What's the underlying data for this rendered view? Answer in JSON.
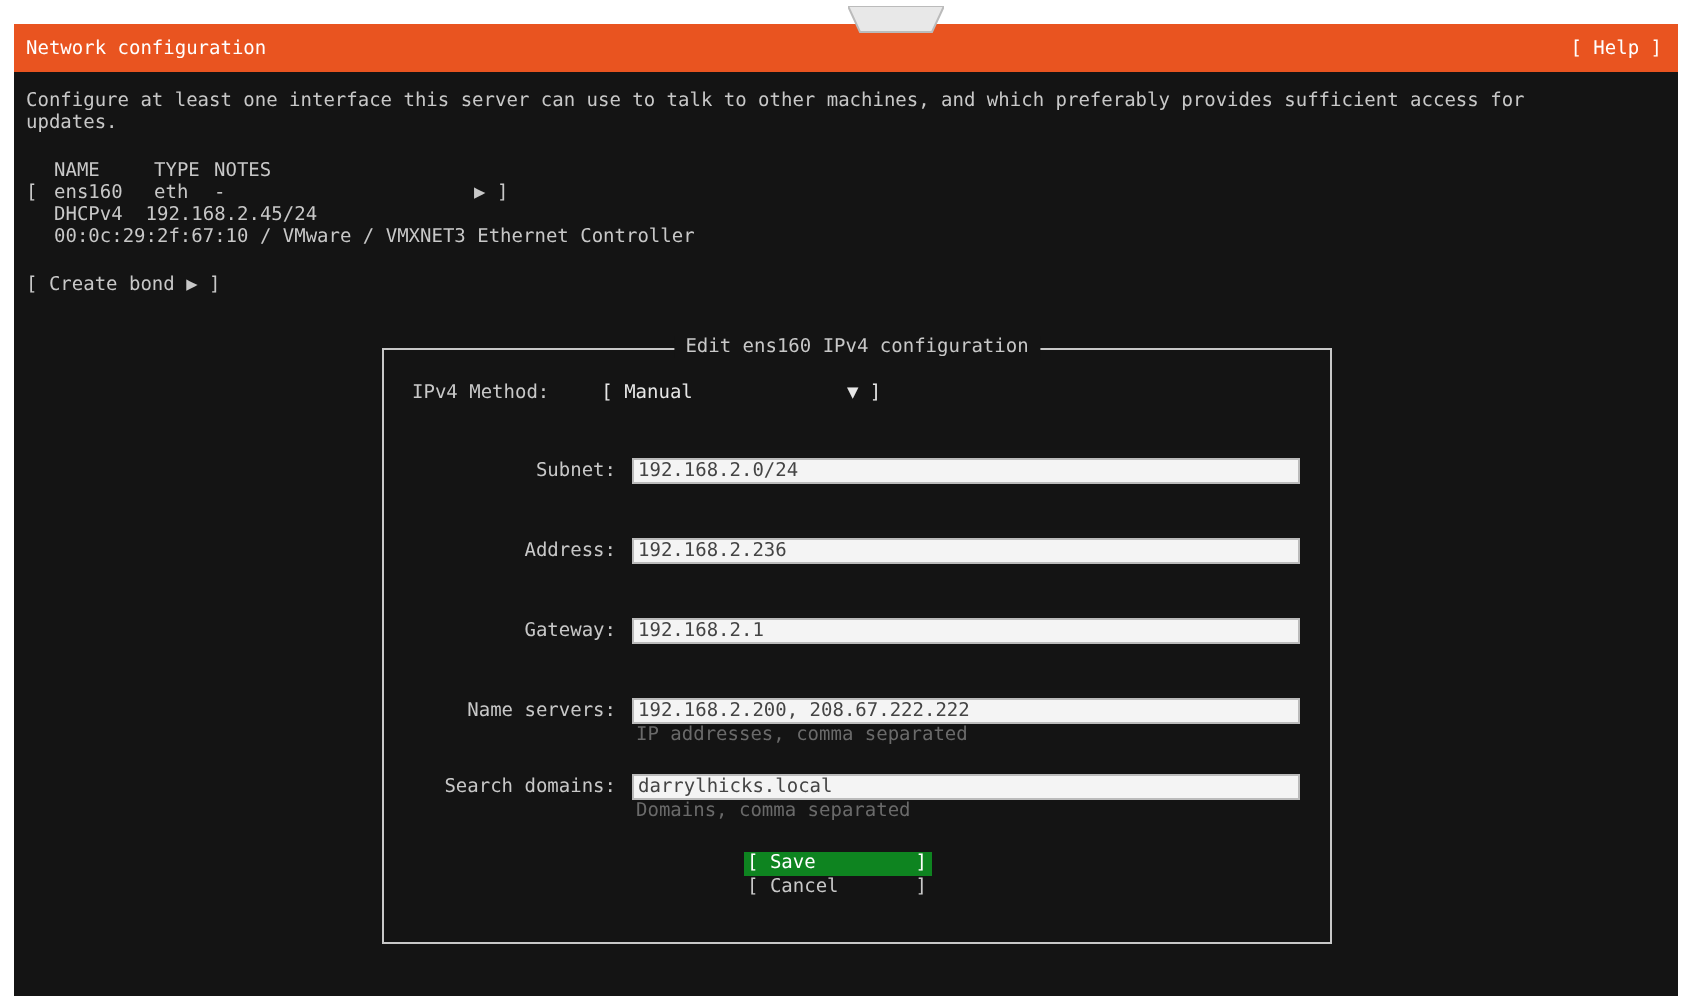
{
  "header": {
    "title": "Network configuration",
    "help": "[ Help ]"
  },
  "intro": "Configure at least one interface this server can use to talk to other machines, and which preferably provides sufficient access for updates.",
  "interfaces": {
    "columns": [
      "NAME",
      "TYPE",
      "NOTES"
    ],
    "rows": [
      {
        "open": "[",
        "name": "ens160",
        "type": "eth",
        "notes": "-",
        "arrow": "▶ ]",
        "details": [
          "DHCPv4  192.168.2.45/24",
          "00:0c:29:2f:67:10 / VMware / VMXNET3 Ethernet Controller"
        ]
      }
    ]
  },
  "create_bond": "[ Create bond ▶ ]",
  "dialog": {
    "title": "Edit ens160 IPv4 configuration",
    "method": {
      "label": "IPv4 Method:",
      "open": "[",
      "value": "Manual",
      "arrow": "▼ ]"
    },
    "fields": [
      {
        "label": "Subnet:",
        "value": "192.168.2.0/24"
      },
      {
        "label": "Address:",
        "value": "192.168.2.236"
      },
      {
        "label": "Gateway:",
        "value": "192.168.2.1"
      },
      {
        "label": "Name servers:",
        "value": "192.168.2.200, 208.67.222.222",
        "hint": "IP addresses, comma separated"
      },
      {
        "label": "Search domains:",
        "value": "darrylhicks.local",
        "hint": "Domains, comma separated"
      }
    ],
    "buttons": [
      {
        "open": "[",
        "label": "Save",
        "close": "]",
        "selected": true
      },
      {
        "open": "[",
        "label": "Cancel",
        "close": "]",
        "selected": false
      }
    ]
  }
}
